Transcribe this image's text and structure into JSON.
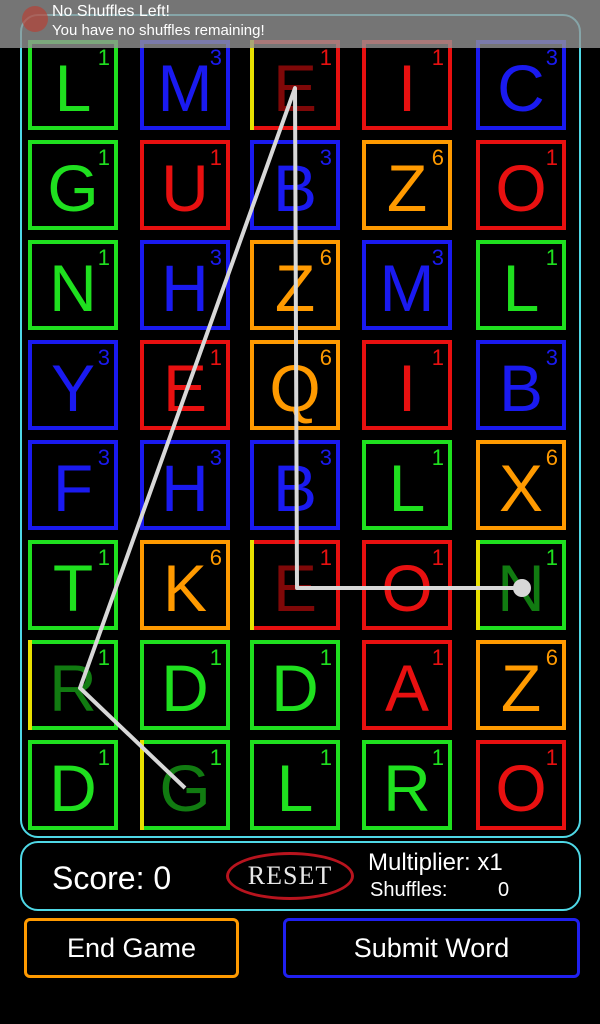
{
  "toast": {
    "title": "No Shuffles Left!",
    "message": "You have no shuffles remaining!"
  },
  "grid": {
    "rows": [
      [
        {
          "l": "L",
          "p": "1",
          "c": "green"
        },
        {
          "l": "M",
          "p": "3",
          "c": "blue"
        },
        {
          "l": "E",
          "p": "1",
          "c": "red",
          "sel": true
        },
        {
          "l": "I",
          "p": "1",
          "c": "red"
        },
        {
          "l": "C",
          "p": "3",
          "c": "blue"
        }
      ],
      [
        {
          "l": "G",
          "p": "1",
          "c": "green"
        },
        {
          "l": "U",
          "p": "1",
          "c": "red"
        },
        {
          "l": "B",
          "p": "3",
          "c": "blue"
        },
        {
          "l": "Z",
          "p": "6",
          "c": "orange"
        },
        {
          "l": "O",
          "p": "1",
          "c": "red"
        }
      ],
      [
        {
          "l": "N",
          "p": "1",
          "c": "green"
        },
        {
          "l": "H",
          "p": "3",
          "c": "blue"
        },
        {
          "l": "Z",
          "p": "6",
          "c": "orange"
        },
        {
          "l": "M",
          "p": "3",
          "c": "blue"
        },
        {
          "l": "L",
          "p": "1",
          "c": "green"
        }
      ],
      [
        {
          "l": "Y",
          "p": "3",
          "c": "blue"
        },
        {
          "l": "E",
          "p": "1",
          "c": "red"
        },
        {
          "l": "Q",
          "p": "6",
          "c": "orange"
        },
        {
          "l": "I",
          "p": "1",
          "c": "red"
        },
        {
          "l": "B",
          "p": "3",
          "c": "blue"
        }
      ],
      [
        {
          "l": "F",
          "p": "3",
          "c": "blue"
        },
        {
          "l": "H",
          "p": "3",
          "c": "blue"
        },
        {
          "l": "B",
          "p": "3",
          "c": "blue"
        },
        {
          "l": "L",
          "p": "1",
          "c": "green"
        },
        {
          "l": "X",
          "p": "6",
          "c": "orange"
        }
      ],
      [
        {
          "l": "T",
          "p": "1",
          "c": "green"
        },
        {
          "l": "K",
          "p": "6",
          "c": "orange"
        },
        {
          "l": "E",
          "p": "1",
          "c": "red",
          "sel": true
        },
        {
          "l": "O",
          "p": "1",
          "c": "red"
        },
        {
          "l": "N",
          "p": "1",
          "c": "green",
          "sel": true
        }
      ],
      [
        {
          "l": "R",
          "p": "1",
          "c": "green",
          "sel": true
        },
        {
          "l": "D",
          "p": "1",
          "c": "green"
        },
        {
          "l": "D",
          "p": "1",
          "c": "green"
        },
        {
          "l": "A",
          "p": "1",
          "c": "red"
        },
        {
          "l": "Z",
          "p": "6",
          "c": "orange"
        }
      ],
      [
        {
          "l": "D",
          "p": "1",
          "c": "green"
        },
        {
          "l": "G",
          "p": "1",
          "c": "green",
          "sel": true
        },
        {
          "l": "L",
          "p": "1",
          "c": "green"
        },
        {
          "l": "R",
          "p": "1",
          "c": "green"
        },
        {
          "l": "O",
          "p": "1",
          "c": "red"
        }
      ]
    ]
  },
  "colors": {
    "green": "#1fe01f",
    "blue": "#1a1af0",
    "red": "#e81010",
    "orange": "#ff9a00",
    "accent": "#4fd8e6",
    "selection": "#e8e000"
  },
  "status": {
    "score_label": "Score: 0",
    "reset_label": "RESET",
    "multiplier_label": "Multiplier: x1",
    "shuffles_label": "Shuffles:",
    "shuffles_value": "0"
  },
  "buttons": {
    "end_game": "End Game",
    "submit_word": "Submit Word"
  }
}
